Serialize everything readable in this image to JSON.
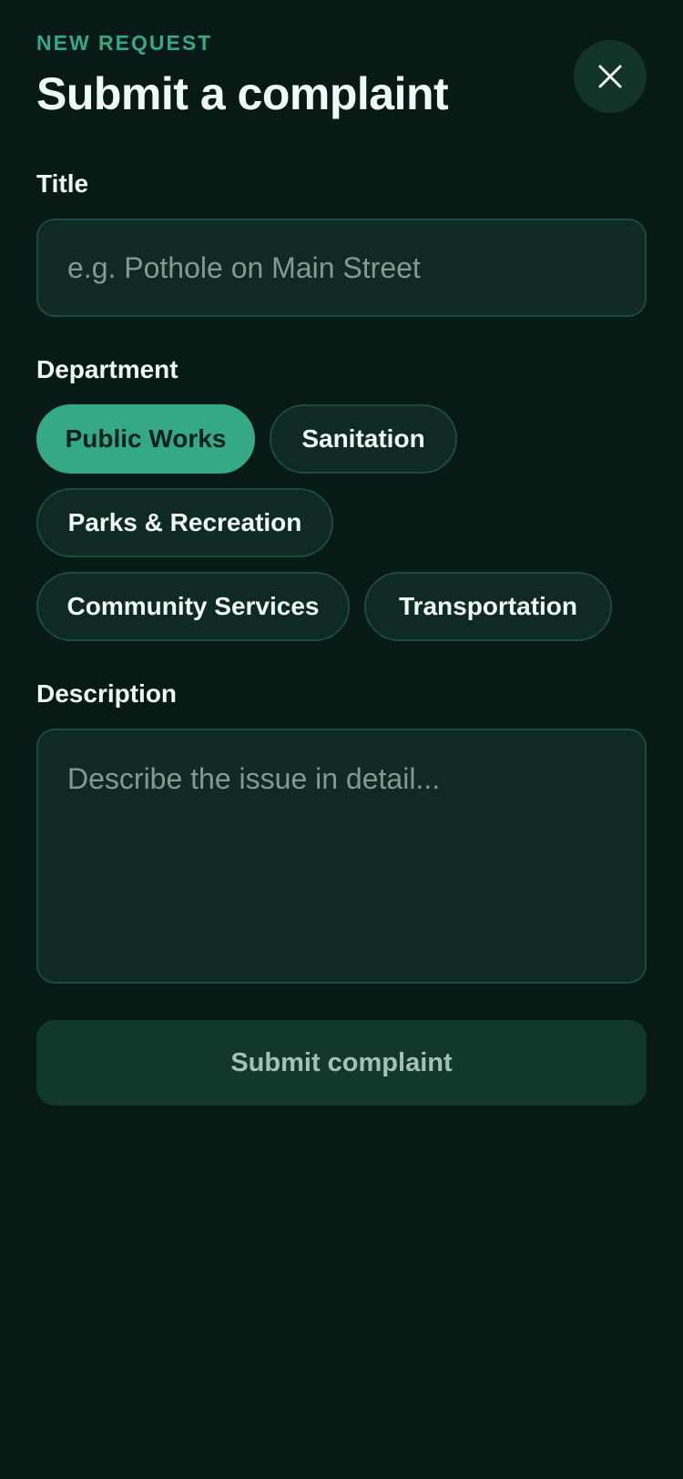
{
  "header": {
    "eyebrow": "NEW REQUEST",
    "title": "Submit a complaint",
    "close_icon": "close-icon"
  },
  "form": {
    "title_field": {
      "label": "Title",
      "placeholder": "e.g. Pothole on Main Street",
      "value": ""
    },
    "department": {
      "label": "Department",
      "selected": "Public Works",
      "options": [
        "Public Works",
        "Sanitation",
        "Parks & Recreation",
        "Community Services",
        "Transportation"
      ]
    },
    "description_field": {
      "label": "Description",
      "placeholder": "Describe the issue in detail...",
      "value": ""
    },
    "submit_label": "Submit complaint"
  },
  "colors": {
    "background": "#071a16",
    "accent": "#35a886",
    "field_background": "#0f2a24",
    "field_border": "#1d4a3d",
    "submit_background": "#12382d",
    "submit_text": "#a4c0b7"
  }
}
